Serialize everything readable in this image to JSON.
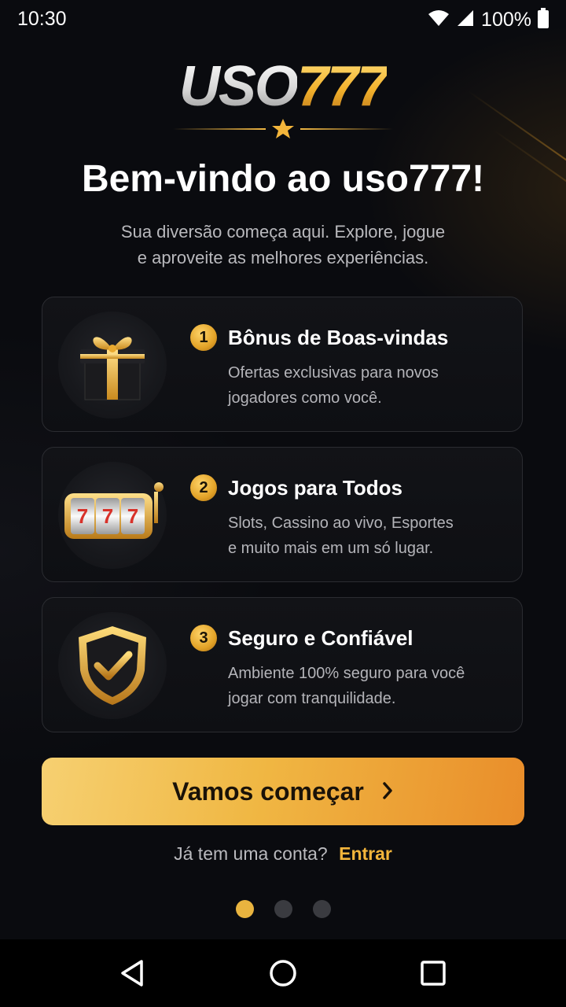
{
  "status_bar": {
    "time": "10:30",
    "battery_text": "100%",
    "icons": [
      "wifi-icon",
      "signal-icon",
      "battery-icon"
    ]
  },
  "logo": {
    "part1": "USO",
    "part2": "777"
  },
  "welcome": {
    "title": "Bem-vindo ao uso777!",
    "subtitle_line1": "Sua diversão começa aqui. Explore, jogue",
    "subtitle_line2": "e aproveite as melhores experiências."
  },
  "features": [
    {
      "number": "1",
      "title": "Bônus de Boas-vindas",
      "desc_line1": "Ofertas exclusivas para novos",
      "desc_line2": "jogadores como você.",
      "icon": "gift-box-icon"
    },
    {
      "number": "2",
      "title": "Jogos para Todos",
      "desc_line1": "Slots, Cassino ao vivo, Esportes",
      "desc_line2": "e muito mais em um só lugar.",
      "icon": "slot-machine-icon"
    },
    {
      "number": "3",
      "title": "Seguro e Confiável",
      "desc_line1": "Ambiente 100% seguro para você",
      "desc_line2": "jogar com tranquilidade.",
      "icon": "shield-check-icon"
    }
  ],
  "cta": {
    "label": "Vamos começar",
    "icon": "chevron-right-icon"
  },
  "login": {
    "prompt": "Já tem uma conta?",
    "link": "Entrar"
  },
  "pagination": {
    "total": 3,
    "active_index": 0
  },
  "colors": {
    "background": "#0a0b0f",
    "accent_gold": "#f0b743",
    "cta_gradient_end": "#e98d2a",
    "card_border": "#2b2c31"
  },
  "nav_bar": {
    "icons": [
      "back-triangle-icon",
      "home-circle-icon",
      "recents-square-icon"
    ]
  }
}
